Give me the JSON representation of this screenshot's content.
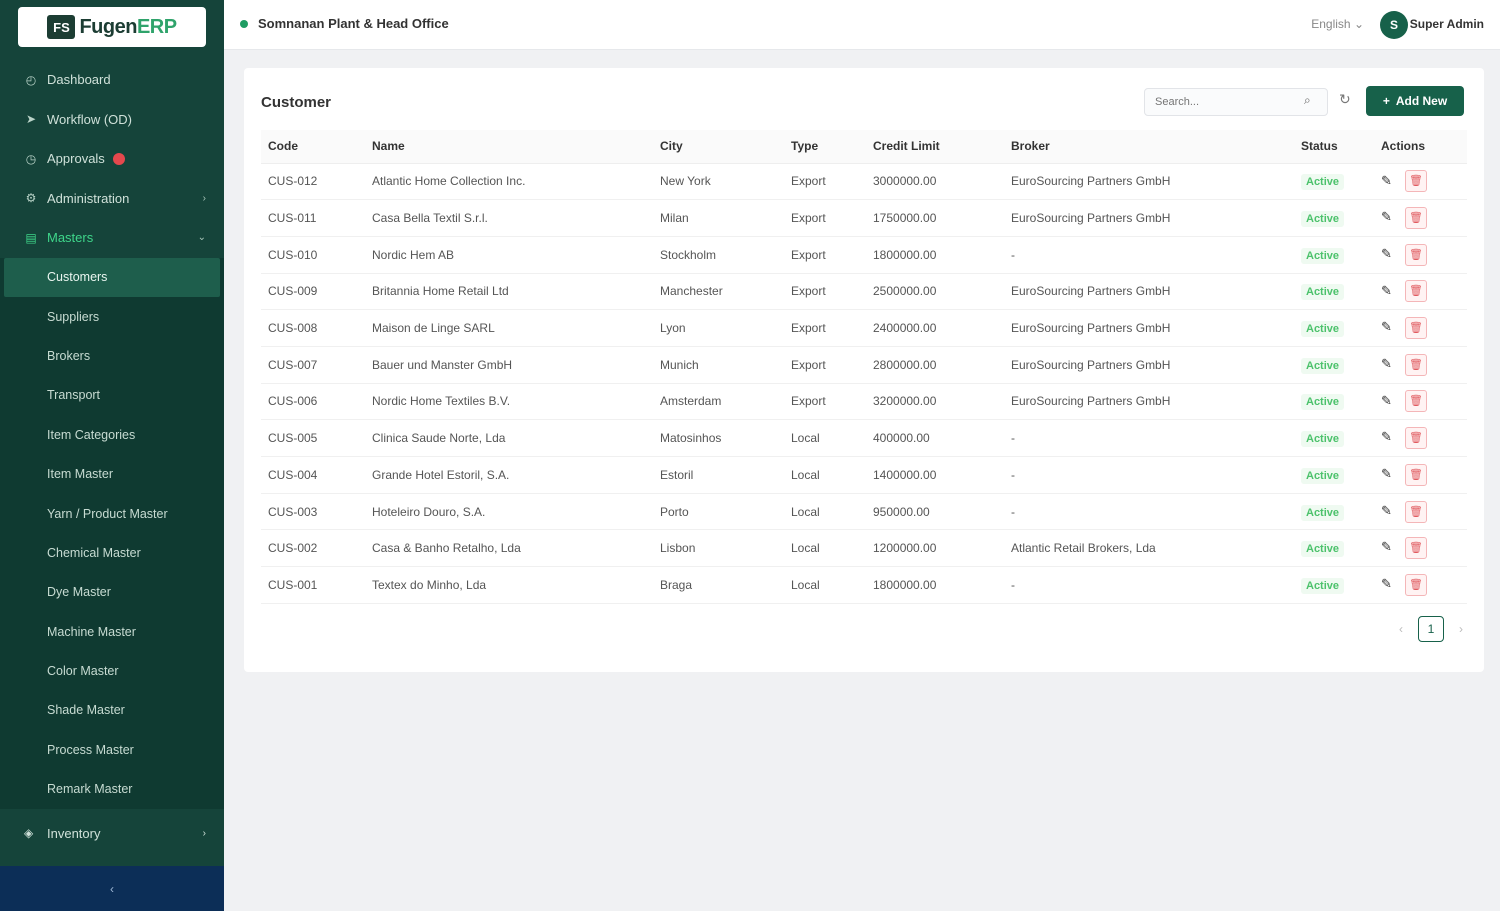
{
  "logo": {
    "mark": "FS",
    "text_main": "Fugen",
    "text_accent": "ERP"
  },
  "sidebar": {
    "items": [
      {
        "label": "Dashboard",
        "icon": "dashboard-icon",
        "glyph": "◴"
      },
      {
        "label": "Workflow (OD)",
        "icon": "send-icon",
        "glyph": "➤"
      },
      {
        "label": "Approvals",
        "icon": "clock-icon",
        "glyph": "◷"
      },
      {
        "label": "Administration",
        "icon": "gear-icon",
        "glyph": "⚙",
        "chevron": "›"
      },
      {
        "label": "Masters",
        "icon": "database-icon",
        "glyph": "▤",
        "chevron": "⌄"
      }
    ],
    "masters_sub": [
      "Customers",
      "Suppliers",
      "Brokers",
      "Transport",
      "Item Categories",
      "Item Master",
      "Yarn / Product Master",
      "Chemical Master",
      "Dye Master",
      "Machine Master",
      "Color Master",
      "Shade Master",
      "Process Master",
      "Remark Master"
    ],
    "bottom_item": {
      "label": "Inventory",
      "glyph": "◈",
      "chevron": "›"
    },
    "collapse_glyph": "‹"
  },
  "header": {
    "org": "Somnanan Plant & Head Office",
    "language": "English ⌄",
    "avatar_initial": "S",
    "username": "Super Admin"
  },
  "card": {
    "title": "Customer",
    "search_placeholder": "Search...",
    "search_glyph": "⌕",
    "refresh_glyph": "↻",
    "add_glyph": "+",
    "add_label": "Add New"
  },
  "table": {
    "columns": [
      "Code",
      "Name",
      "City",
      "Type",
      "Credit Limit",
      "Broker",
      "Status",
      "Actions"
    ],
    "rows": [
      [
        "CUS-012",
        "Atlantic Home Collection Inc.",
        "New York",
        "Export",
        "3000000.00",
        "EuroSourcing Partners GmbH",
        "Active"
      ],
      [
        "CUS-011",
        "Casa Bella Textil S.r.l.",
        "Milan",
        "Export",
        "1750000.00",
        "EuroSourcing Partners GmbH",
        "Active"
      ],
      [
        "CUS-010",
        "Nordic Hem AB",
        "Stockholm",
        "Export",
        "1800000.00",
        "-",
        "Active"
      ],
      [
        "CUS-009",
        "Britannia Home Retail Ltd",
        "Manchester",
        "Export",
        "2500000.00",
        "EuroSourcing Partners GmbH",
        "Active"
      ],
      [
        "CUS-008",
        "Maison de Linge SARL",
        "Lyon",
        "Export",
        "2400000.00",
        "EuroSourcing Partners GmbH",
        "Active"
      ],
      [
        "CUS-007",
        "Bauer und Manster GmbH",
        "Munich",
        "Export",
        "2800000.00",
        "EuroSourcing Partners GmbH",
        "Active"
      ],
      [
        "CUS-006",
        "Nordic Home Textiles B.V.",
        "Amsterdam",
        "Export",
        "3200000.00",
        "EuroSourcing Partners GmbH",
        "Active"
      ],
      [
        "CUS-005",
        "Clinica Saude Norte, Lda",
        "Matosinhos",
        "Local",
        "400000.00",
        "-",
        "Active"
      ],
      [
        "CUS-004",
        "Grande Hotel Estoril, S.A.",
        "Estoril",
        "Local",
        "1400000.00",
        "-",
        "Active"
      ],
      [
        "CUS-003",
        "Hoteleiro Douro, S.A.",
        "Porto",
        "Local",
        "950000.00",
        "-",
        "Active"
      ],
      [
        "CUS-002",
        "Casa & Banho Retalho, Lda",
        "Lisbon",
        "Local",
        "1200000.00",
        "Atlantic Retail Brokers, Lda",
        "Active"
      ],
      [
        "CUS-001",
        "Textex do Minho, Lda",
        "Braga",
        "Local",
        "1800000.00",
        "-",
        "Active"
      ]
    ]
  },
  "pager": {
    "prev": "‹",
    "current": "1",
    "next": "›"
  }
}
